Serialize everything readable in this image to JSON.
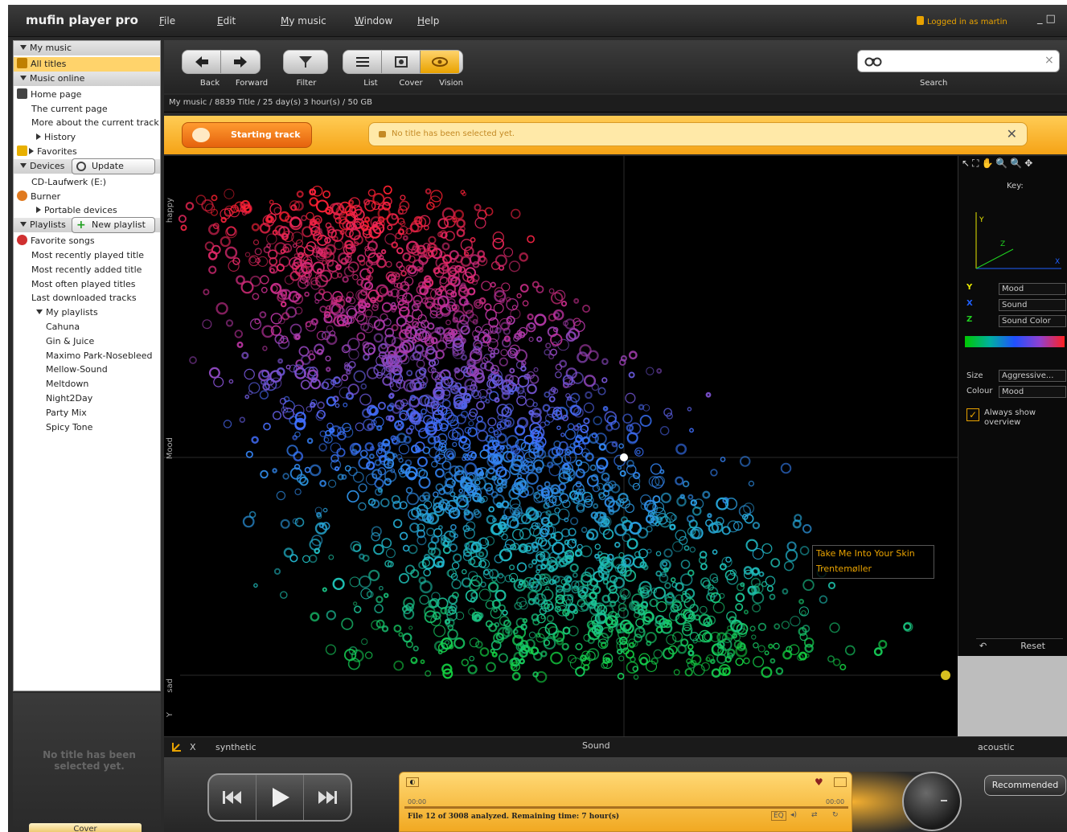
{
  "app": {
    "title": "mufin player pro",
    "menu": [
      "File",
      "Edit",
      "My music",
      "Window",
      "Help"
    ],
    "login_status": "Logged in as martin"
  },
  "sidebar": {
    "rows": [
      {
        "label": "My music",
        "kind": "head",
        "icon": "triangle-down-icon"
      },
      {
        "label": "All titles",
        "kind": "selected",
        "icon": "music-note-icon"
      },
      {
        "label": "Music online",
        "kind": "head",
        "icon": "triangle-down-icon"
      },
      {
        "label": "Home page",
        "kind": "item",
        "icon": "home-icon"
      },
      {
        "label": "The current page",
        "kind": "item",
        "icon": ""
      },
      {
        "label": "More about the current track",
        "kind": "item",
        "icon": ""
      },
      {
        "label": "History",
        "kind": "sub",
        "icon": "triangle-right-icon"
      },
      {
        "label": "Favorites",
        "kind": "sub",
        "icon": "star-icon"
      },
      {
        "label": "Devices",
        "kind": "head",
        "icon": "triangle-down-icon"
      },
      {
        "label": "CD-Laufwerk (E:)",
        "kind": "item",
        "icon": ""
      },
      {
        "label": "Burner",
        "kind": "item",
        "icon": "burner-icon"
      },
      {
        "label": "Portable devices",
        "kind": "sub",
        "icon": "triangle-right-icon"
      },
      {
        "label": "Playlists",
        "kind": "head",
        "icon": "triangle-down-icon"
      },
      {
        "label": "Favorite songs",
        "kind": "item",
        "icon": "heart-icon"
      },
      {
        "label": "Most recently played title",
        "kind": "item",
        "icon": ""
      },
      {
        "label": "Most recently added title",
        "kind": "item",
        "icon": ""
      },
      {
        "label": "Most often played titles",
        "kind": "item",
        "icon": ""
      },
      {
        "label": "Last downloaded tracks",
        "kind": "item",
        "icon": ""
      },
      {
        "label": "My playlists",
        "kind": "sub",
        "icon": "triangle-down-icon"
      },
      {
        "label": "Cahuna",
        "kind": "nested",
        "icon": ""
      },
      {
        "label": "Gin & Juice",
        "kind": "nested",
        "icon": ""
      },
      {
        "label": "Maximo Park-Nosebleed",
        "kind": "nested",
        "icon": ""
      },
      {
        "label": "Mellow-Sound",
        "kind": "nested",
        "icon": ""
      },
      {
        "label": "Meltdown",
        "kind": "nested",
        "icon": ""
      },
      {
        "label": "Night2Day",
        "kind": "nested",
        "icon": ""
      },
      {
        "label": "Party Mix",
        "kind": "nested",
        "icon": ""
      },
      {
        "label": "Spicy Tone",
        "kind": "nested",
        "icon": ""
      }
    ],
    "update_label": "Update",
    "new_playlist_label": "New playlist",
    "no_title": "No title has been selected yet.",
    "cover_tab": "Cover"
  },
  "toolbar": {
    "back": "Back",
    "forward": "Forward",
    "filter": "Filter",
    "list": "List",
    "cover": "Cover",
    "vision": "Vision",
    "search_label": "Search",
    "search_value": ""
  },
  "breadcrumb": {
    "text": "My music  /  8839 Title  /  25 day(s) 3 hour(s)  /  50 GB"
  },
  "start": {
    "button": "Starting track",
    "message": "No title has been selected yet."
  },
  "plot": {
    "y_top": "happy",
    "y_mid": "Mood",
    "y_bottom": "sad",
    "y_letter": "Y",
    "x_letter": "X",
    "x_left": "synthetic",
    "x_mid": "Sound",
    "x_right": "acoustic",
    "tooltip_title": "Take Me Into Your Skin",
    "tooltip_artist": "Trentemøller",
    "colors": {
      "top": "#ff2030",
      "upper": "#c0309a",
      "mid": "#3a70ff",
      "lower": "#20b8c8",
      "bottom": "#14d040"
    }
  },
  "key": {
    "title": "Key:",
    "y_label": "Y",
    "x_label": "X",
    "z_label": "Z",
    "y_value": "Mood",
    "x_value": "Sound",
    "z_value": "Sound Color",
    "size_label": "Size",
    "size_value": "Aggressive...",
    "colour_label": "Colour",
    "colour_value": "Mood",
    "always_show": "Always show overview",
    "reset": "Reset"
  },
  "player": {
    "time_start": "00:00",
    "time_end": "00:00",
    "status": "File 12 of 3008 analyzed. Remaining time: 7 hour(s)",
    "eq": "EQ",
    "recommended": "Recommended"
  }
}
